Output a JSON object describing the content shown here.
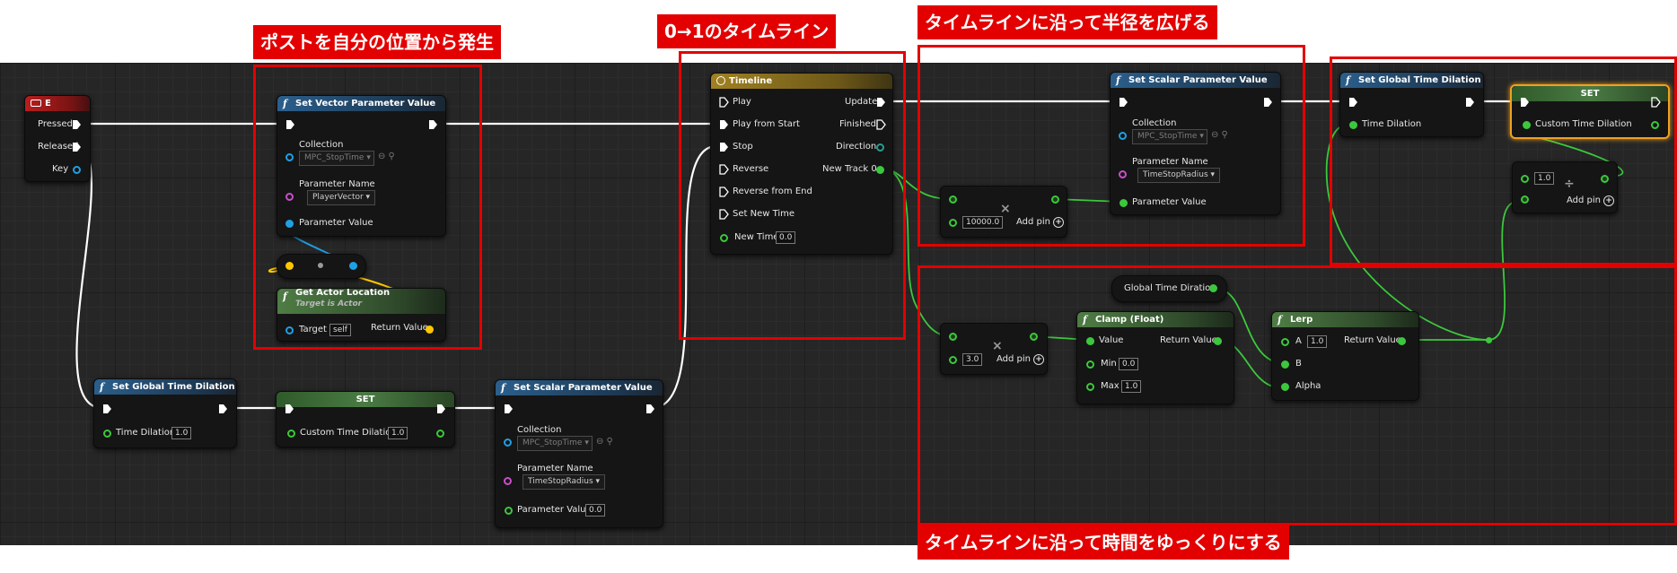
{
  "annotations": {
    "post_from_self": "ポストを自分の位置から発生",
    "timeline_0_1": "0→1のタイムライン",
    "expand_radius": "タイムラインに沿って半径を広げる",
    "slow_time": "タイムラインに沿って時間をゆっくりにする"
  },
  "colors": {
    "exec": "#ffffff",
    "float": "#3cc83c",
    "vector": "#ffc800",
    "object": "#1ea0e6",
    "name": "#c850c8",
    "annotation": "#e30000"
  },
  "nodes": {
    "event_e": {
      "title": "E",
      "icon": "keyboard-icon",
      "pins": {
        "pressed": "Pressed",
        "released": "Released",
        "key": "Key"
      }
    },
    "set_vector_param": {
      "title": "Set Vector Parameter Value",
      "icon": "function-icon",
      "collection_label": "Collection",
      "collection_value": "MPC_StopTime",
      "param_name_label": "Parameter Name",
      "param_name_value": "PlayerVector",
      "param_value_label": "Parameter Value"
    },
    "get_actor_location": {
      "title": "Get Actor Location",
      "subtitle": "Target is Actor",
      "target_label": "Target",
      "target_value": "self",
      "return_label": "Return Value"
    },
    "timeline": {
      "title": "Timeline",
      "icon": "clock-icon",
      "inputs": [
        "Play",
        "Play from Start",
        "Stop",
        "Reverse",
        "Reverse from End",
        "Set New Time"
      ],
      "new_time_label": "New Time",
      "new_time_value": "0.0",
      "outputs": [
        "Update",
        "Finished",
        "Direction",
        "New Track 0"
      ]
    },
    "multiply_radius": {
      "value": "10000.0",
      "add_pin": "Add pin"
    },
    "set_scalar_top": {
      "title": "Set Scalar Parameter Value",
      "collection_label": "Collection",
      "collection_value": "MPC_StopTime",
      "param_name_label": "Parameter Name",
      "param_name_value": "TimeStopRadius",
      "param_value_label": "Parameter Value"
    },
    "set_global_dilation_top": {
      "title": "Set Global Time Dilation",
      "time_dilation_label": "Time Dilation"
    },
    "set_custom_top": {
      "title": "SET",
      "label": "Custom Time Dilation"
    },
    "divide": {
      "value": "1.0",
      "add_pin": "Add pin"
    },
    "global_time_diration": {
      "label": "Global Time Diration"
    },
    "multiply_time": {
      "value": "3.0",
      "add_pin": "Add pin"
    },
    "clamp": {
      "title": "Clamp (Float)",
      "value_label": "Value",
      "return_label": "Return Value",
      "min_label": "Min",
      "min_value": "0.0",
      "max_label": "Max",
      "max_value": "1.0"
    },
    "lerp": {
      "title": "Lerp",
      "a_label": "A",
      "a_value": "1.0",
      "b_label": "B",
      "alpha_label": "Alpha",
      "return_label": "Return Value"
    },
    "set_global_dilation_bottom": {
      "title": "Set Global Time Dilation",
      "time_dilation_label": "Time Dilation",
      "time_dilation_value": "1.0"
    },
    "set_custom_bottom": {
      "title": "SET",
      "label": "Custom Time Dilation",
      "value": "1.0"
    },
    "set_scalar_bottom": {
      "title": "Set Scalar Parameter Value",
      "collection_label": "Collection",
      "collection_value": "MPC_StopTime",
      "param_name_label": "Parameter Name",
      "param_name_value": "TimeStopRadius",
      "param_value_label": "Parameter Value",
      "param_value_value": "0.0"
    }
  }
}
